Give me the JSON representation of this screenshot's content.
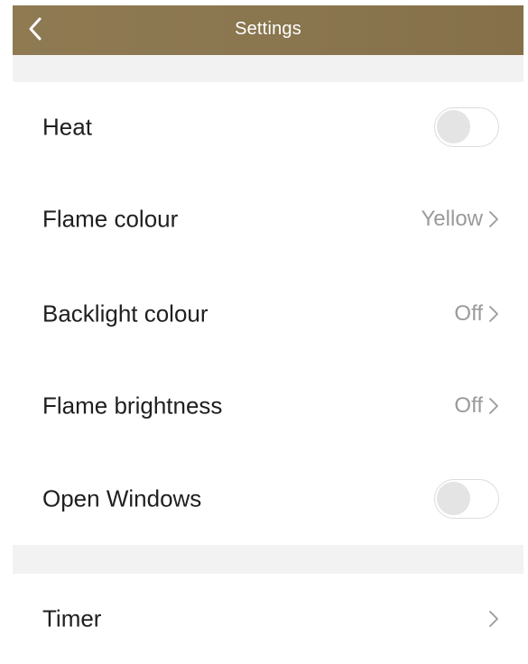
{
  "header": {
    "title": "Settings",
    "back_icon": "chevron-left-icon"
  },
  "colors": {
    "header_background": "#8a764f",
    "section_gap": "#f2f2f2",
    "value_text": "#9a9a9a",
    "toggle_off_knob": "#e4e4e4"
  },
  "settings": {
    "heat": {
      "label": "Heat",
      "enabled": false
    },
    "flame_colour": {
      "label": "Flame colour",
      "value": "Yellow"
    },
    "backlight_colour": {
      "label": "Backlight colour",
      "value": "Off"
    },
    "flame_brightness": {
      "label": "Flame brightness",
      "value": "Off"
    },
    "open_windows": {
      "label": "Open Windows",
      "enabled": false
    }
  },
  "timer": {
    "label": "Timer"
  }
}
